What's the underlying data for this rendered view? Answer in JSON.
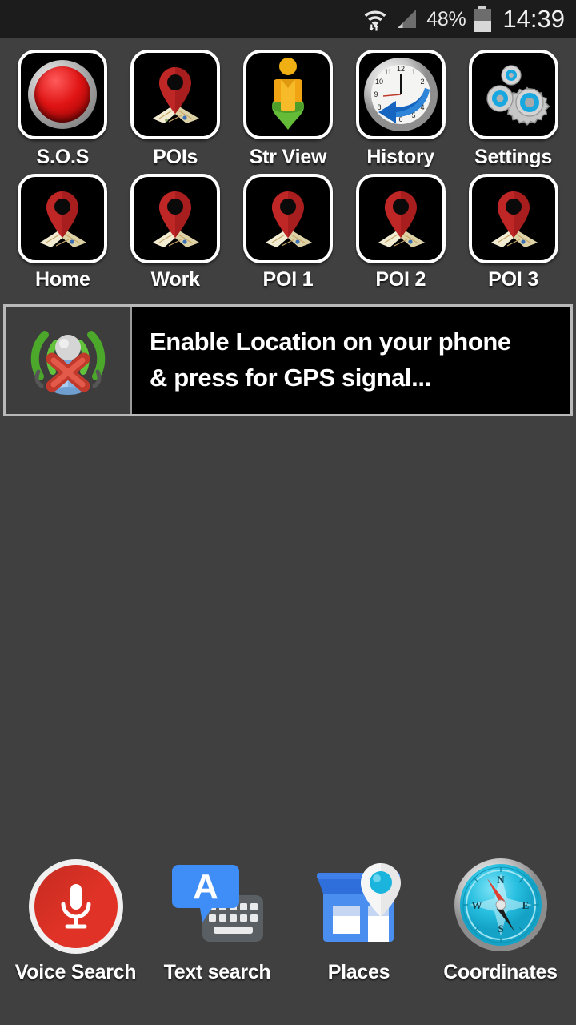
{
  "status_bar": {
    "wifi_icon": "wifi-icon",
    "data_transfer_icon": "data-updown-icon",
    "cell_signal_icon": "cell-signal-icon",
    "battery_percent": "48%",
    "battery_icon": "battery-icon",
    "clock": "14:39"
  },
  "app_grid": {
    "rows": [
      {
        "items": [
          {
            "label": "S.O.S",
            "icon": "sos-button-icon"
          },
          {
            "label": "POIs",
            "icon": "map-pin-icon"
          },
          {
            "label": "Str View",
            "icon": "street-view-pegman-icon"
          },
          {
            "label": "History",
            "icon": "clock-back-arrow-icon"
          },
          {
            "label": "Settings",
            "icon": "gears-icon"
          }
        ]
      },
      {
        "items": [
          {
            "label": "Home",
            "icon": "map-pin-icon"
          },
          {
            "label": "Work",
            "icon": "map-pin-icon"
          },
          {
            "label": "POI 1",
            "icon": "map-pin-icon"
          },
          {
            "label": "POI 2",
            "icon": "map-pin-icon"
          },
          {
            "label": "POI 3",
            "icon": "map-pin-icon"
          }
        ]
      }
    ]
  },
  "gps_banner": {
    "icon": "gps-signal-disabled-icon",
    "line1": "Enable Location on your phone",
    "line2": "& press for GPS signal..."
  },
  "bottom_bar": {
    "items": [
      {
        "label": "Voice Search",
        "icon": "microphone-icon"
      },
      {
        "label": "Text search",
        "icon": "keyboard-text-icon"
      },
      {
        "label": "Places",
        "icon": "storefront-pin-icon"
      },
      {
        "label": "Coordinates",
        "icon": "compass-icon"
      }
    ]
  },
  "colors": {
    "background": "#404040",
    "status_bar": "#1c1c1c",
    "tile_bg": "#000000",
    "tile_border": "#ffffff",
    "accent_red": "#e01414",
    "accent_blue": "#4285f4",
    "accent_cyan": "#29c4e8",
    "accent_green": "#3ea832"
  }
}
